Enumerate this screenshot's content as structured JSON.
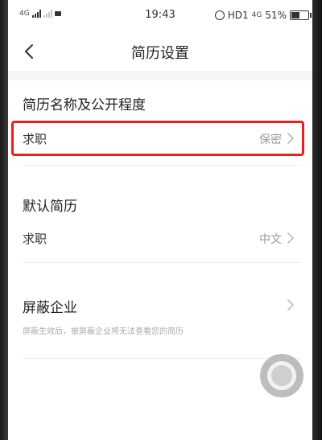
{
  "status_bar": {
    "network_label": "4G",
    "time": "19:43",
    "hd_label": "HD1",
    "net_small": "4G",
    "battery": "51%"
  },
  "header": {
    "title": "简历设置"
  },
  "sections": {
    "name_privacy": {
      "title": "简历名称及公开程度",
      "row": {
        "label": "求职",
        "value": "保密"
      }
    },
    "default_resume": {
      "title": "默认简历",
      "row": {
        "label": "求职",
        "value": "中文"
      }
    },
    "block_company": {
      "title": "屏蔽企业",
      "hint": "屏蔽生效后，被屏蔽企业将无法查看您的简历"
    }
  },
  "colors": {
    "highlight": "#e8201b",
    "muted_text": "#999999",
    "divider": "#ececec"
  }
}
